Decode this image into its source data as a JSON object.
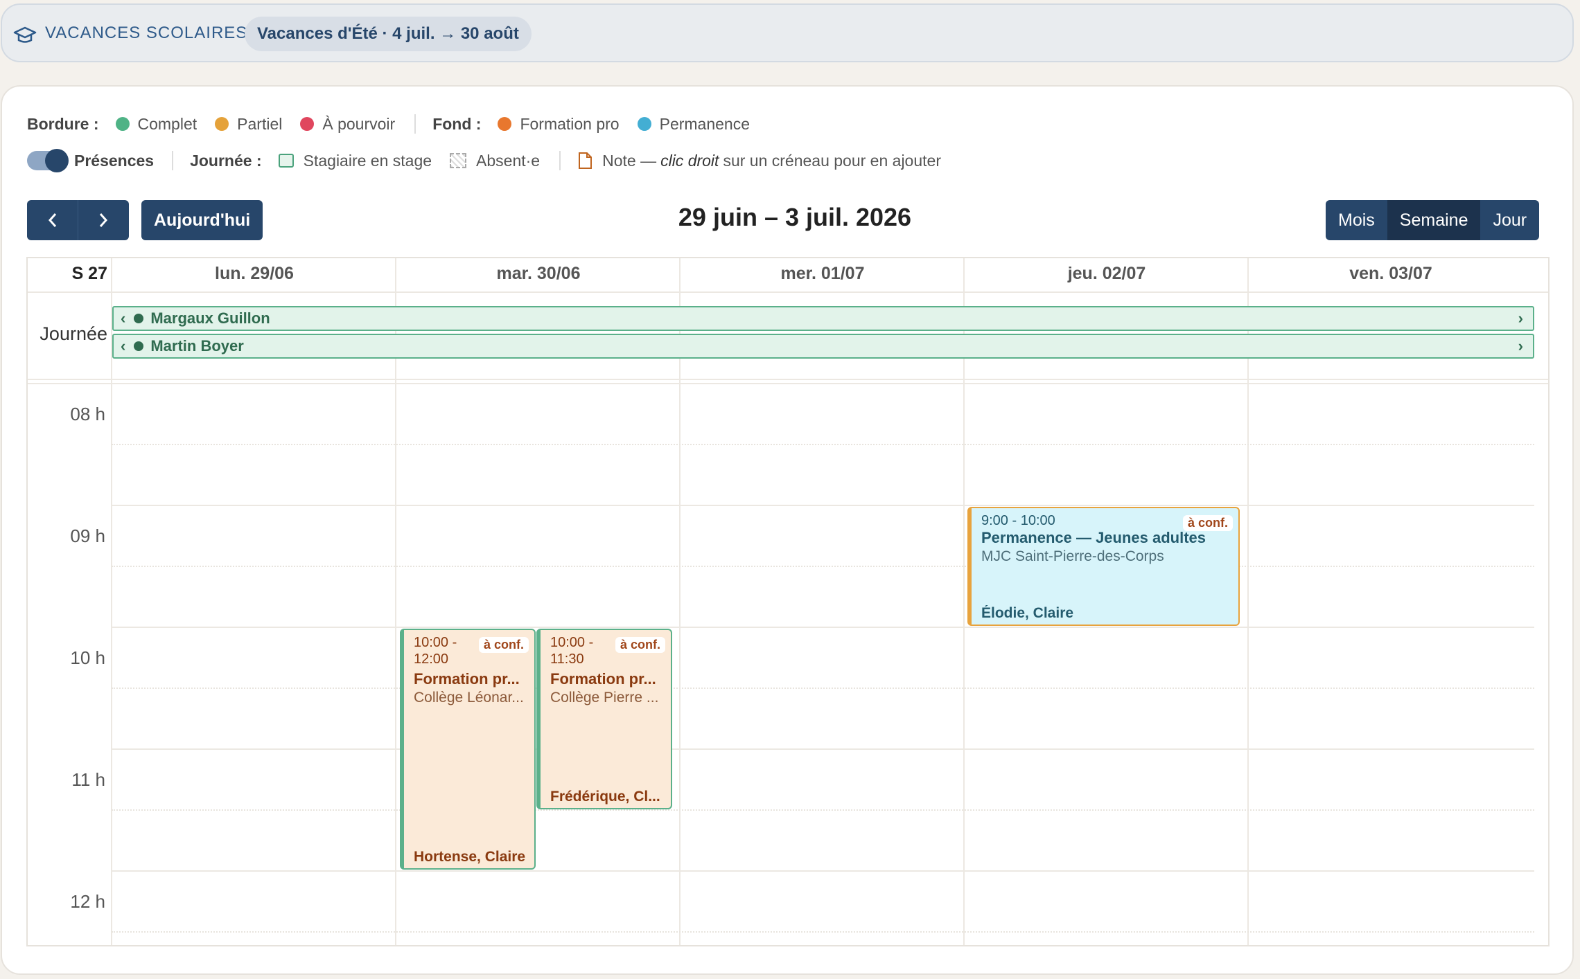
{
  "banner": {
    "title": "VACANCES SCOLAIRES",
    "chip": "Vacances d'Été · 4 juil. → 30 août",
    "icon": "graduation-cap-icon"
  },
  "legend": {
    "border_heading": "Bordure :",
    "border_items": [
      {
        "label": "Complet",
        "color": "#4fb386"
      },
      {
        "label": "Partiel",
        "color": "#e5a23a"
      },
      {
        "label": "À pourvoir",
        "color": "#e0465e"
      }
    ],
    "fill_heading": "Fond :",
    "fill_items": [
      {
        "label": "Formation pro",
        "color": "#e8772e"
      },
      {
        "label": "Permanence",
        "color": "#43aed3"
      }
    ],
    "presence_toggle_label": "Présences",
    "day_heading": "Journée :",
    "stage_label": "Stagiaire en stage",
    "absent_label": "Absent·e",
    "note_label": "Note —",
    "note_hint_em": "clic droit",
    "note_hint_rest": "sur un créneau pour en ajouter"
  },
  "toolbar": {
    "prev_icon": "chevron-left-icon",
    "next_icon": "chevron-right-icon",
    "today_label": "Aujourd'hui",
    "range_title": "29 juin – 3 juil. 2026",
    "views": [
      "Mois",
      "Semaine",
      "Jour"
    ],
    "active_view": "Semaine"
  },
  "calendar": {
    "week_label": "S 27",
    "days": [
      "lun. 29/06",
      "mar. 30/06",
      "mer. 01/07",
      "jeu. 02/07",
      "ven. 03/07"
    ],
    "allday_label": "Journée",
    "allday_items": [
      {
        "name": "Margaux Guillon"
      },
      {
        "name": "Martin Boyer"
      }
    ],
    "hours": [
      "08 h",
      "09 h",
      "10 h",
      "11 h",
      "12 h"
    ],
    "events": [
      {
        "day": "mar. 30/06",
        "time": "10:00 - 12:00",
        "badge": "à conf.",
        "title": "Formation pr...",
        "location": "Collège Léonar...",
        "people": "Hortense, Claire",
        "type": "Formation pro",
        "status": "Complet"
      },
      {
        "day": "mar. 30/06",
        "time": "10:00 - 11:30",
        "badge": "à conf.",
        "title": "Formation pr...",
        "location": "Collège Pierre ...",
        "people": "Frédérique, Cl...",
        "type": "Formation pro",
        "status": "Complet"
      },
      {
        "day": "jeu. 02/07",
        "time": "9:00 - 10:00",
        "badge": "à conf.",
        "title": "Permanence — Jeunes adultes",
        "location": "MJC Saint-Pierre-des-Corps",
        "people": "Élodie, Claire",
        "type": "Permanence",
        "status": "Partiel"
      }
    ]
  }
}
